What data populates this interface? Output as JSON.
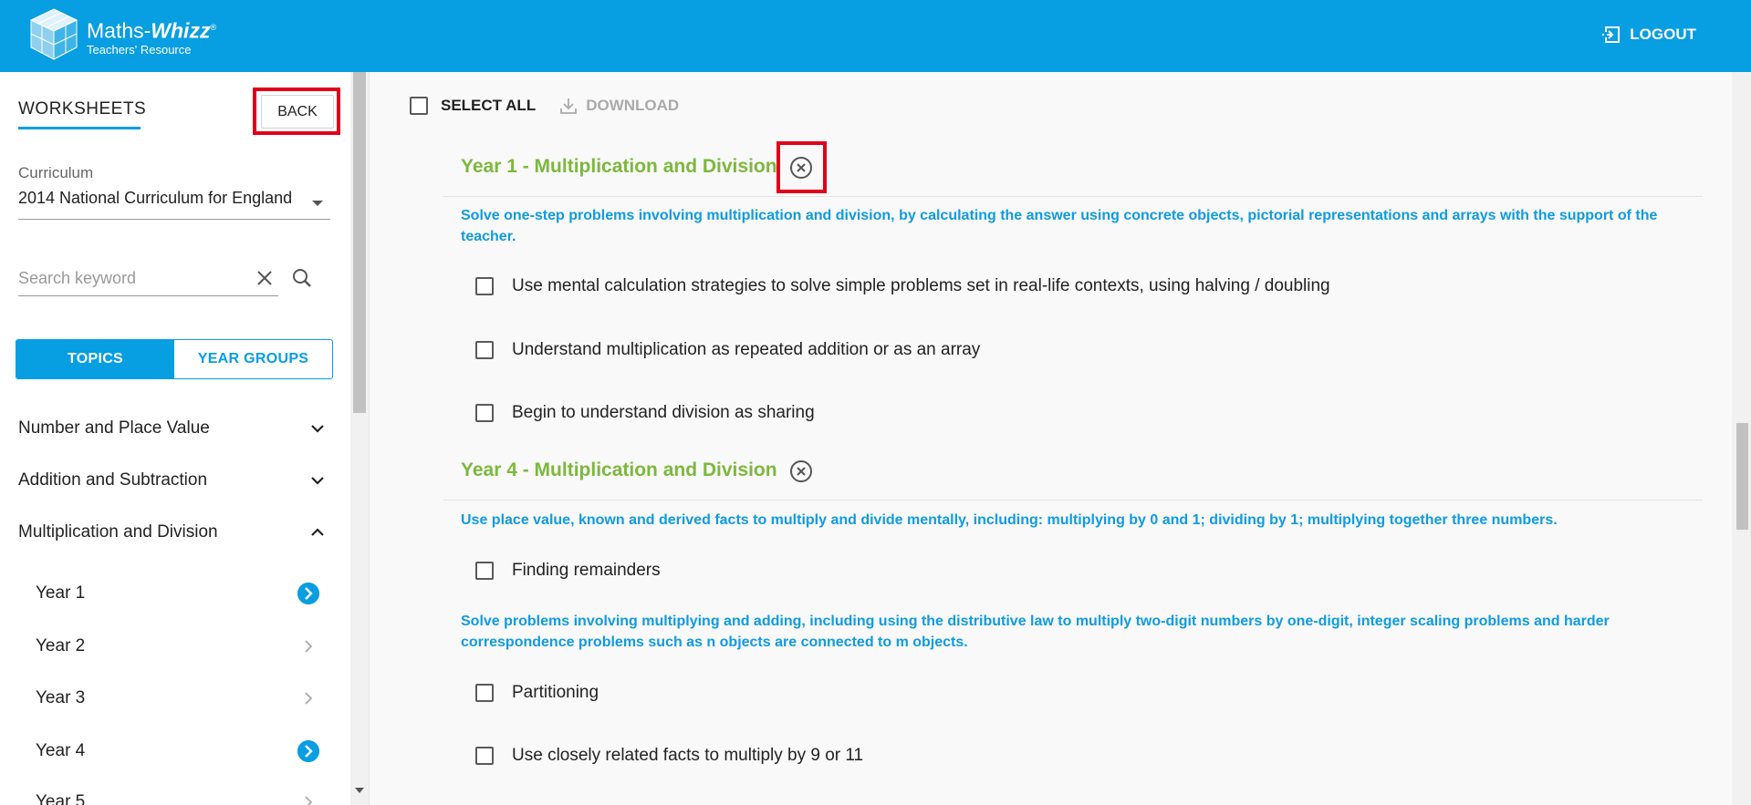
{
  "header": {
    "brand_name_plain": "Maths-",
    "brand_name_bold": "Whizz",
    "brand_reg": "®",
    "brand_sub": "Teachers' Resource",
    "logout_label": "LOGOUT",
    "color": "#079ee2"
  },
  "sidebar": {
    "title": "WORKSHEETS",
    "back_label": "BACK",
    "curriculum_label": "Curriculum",
    "curriculum_value": "2014 National Curriculum for England",
    "search_placeholder": "Search keyword",
    "tabs": [
      {
        "label": "TOPICS",
        "active": true
      },
      {
        "label": "YEAR GROUPS",
        "active": false
      }
    ],
    "topics": [
      {
        "label": "Number and Place Value",
        "expanded": false
      },
      {
        "label": "Addition and Subtraction",
        "expanded": false
      },
      {
        "label": "Multiplication and Division",
        "expanded": true
      }
    ],
    "years": [
      {
        "label": "Year 1",
        "selected": true
      },
      {
        "label": "Year 2",
        "selected": false
      },
      {
        "label": "Year 3",
        "selected": false
      },
      {
        "label": "Year 4",
        "selected": true
      },
      {
        "label": "Year 5",
        "selected": false
      }
    ]
  },
  "main": {
    "select_all_label": "SELECT ALL",
    "download_label": "DOWNLOAD",
    "sections": [
      {
        "title": "Year 1 - Multiplication and Division",
        "objectives": [
          {
            "text": "Solve one-step problems involving multiplication and division, by calculating the answer using concrete objects, pictorial representations and arrays with the support of the teacher.",
            "items": [
              "Use mental calculation strategies to solve simple problems set in real-life contexts, using halving / doubling",
              "Understand multiplication as repeated addition or as an array",
              "Begin to understand division as sharing"
            ]
          }
        ]
      },
      {
        "title": "Year 4 - Multiplication and Division",
        "objectives": [
          {
            "text": "Use place value, known and derived facts to multiply and divide mentally, including: multiplying by 0 and 1; dividing by 1; multiplying together three numbers.",
            "items": [
              "Finding remainders"
            ]
          },
          {
            "text": "Solve problems involving multiplying and adding, including using the distributive law to multiply two-digit numbers by one-digit, integer scaling problems and harder correspondence problems such as n objects are connected to m objects.",
            "items": [
              "Partitioning",
              "Use closely related facts to multiply by 9 or 11"
            ]
          }
        ]
      }
    ]
  },
  "colors": {
    "accent": "#079ee2",
    "section_title": "#7cb83c",
    "highlight": "#e0001b"
  }
}
